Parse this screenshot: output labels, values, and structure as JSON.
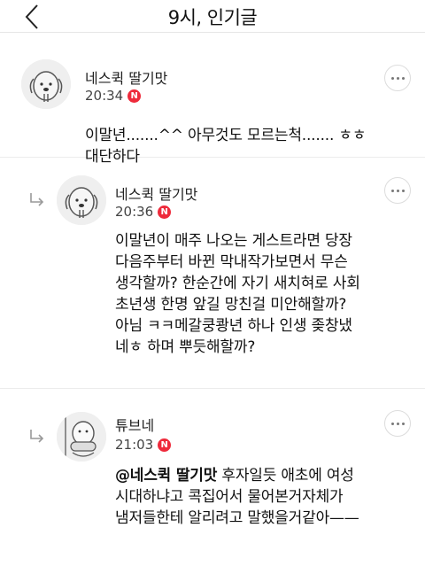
{
  "header": {
    "title": "9시, 인기글"
  },
  "comments": [
    {
      "author": "네스퀵 딸기맛",
      "time": "20:34",
      "badge": "N",
      "body": "이말년.......^^ 아무것도 모르는척....... ㅎㅎ\n대단하다"
    },
    {
      "author": "네스퀵 딸기맛",
      "time": "20:36",
      "badge": "N",
      "body": "이말년이 매주 나오는 게스트라면 당장\n다음주부터 바뀐 막내작가보면서 무슨\n생각할까? 한순간에 자기 새치혀로 사회\n초년생 한명 앞길 망친걸 미안해할까?\n아님 ㅋㅋ메갈쿵쾅년 하나 인생 좆창냈\n네ㅎ 하며 뿌듯해할까?"
    },
    {
      "author": "튜브네",
      "time": "21:03",
      "badge": "N",
      "mention": "@네스퀵 딸기맛",
      "body": "  후자일듯 애초에 여성\n시대하냐고 콕집어서 물어본거자체가\n냄저들한테 알리려고 말했을거같아——"
    }
  ]
}
